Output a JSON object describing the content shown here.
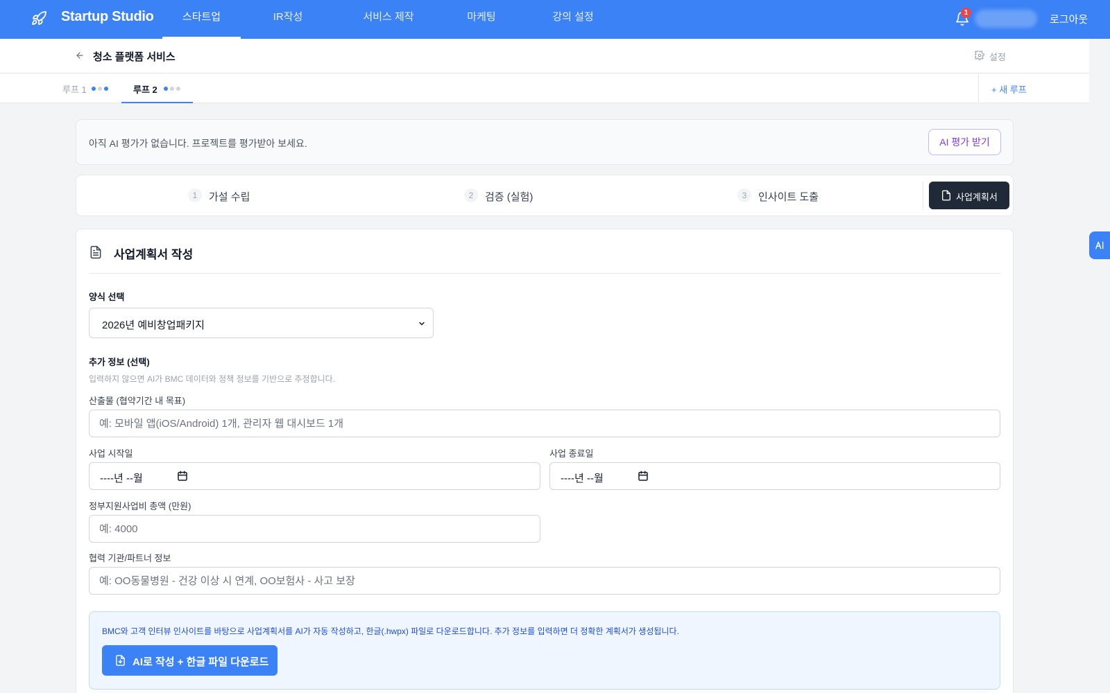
{
  "topnav": {
    "brand": "Startup Studio",
    "items": [
      {
        "label": "스타트업"
      },
      {
        "label": "IR작성"
      },
      {
        "label": "서비스 제작"
      },
      {
        "label": "마케팅"
      },
      {
        "label": "강의 설정"
      }
    ],
    "active_item": "스타트업",
    "notification_count": "1",
    "logout_label": "로그아웃"
  },
  "page_header": {
    "title": "청소 플랫폼 서비스",
    "settings_label": "설정"
  },
  "loops": {
    "tabs": [
      {
        "label": "루프 1",
        "progress": [
          true,
          false,
          true
        ]
      },
      {
        "label": "루프 2",
        "progress": [
          true,
          false,
          false
        ]
      }
    ],
    "active_tab": "루프 2",
    "new_loop_label": "+ 새 루프"
  },
  "ai_eval": {
    "message": "아직 AI 평가가 없습니다. 프로젝트를 평가받아 보세요.",
    "button_label": "AI 평가 받기"
  },
  "steps": {
    "items": [
      {
        "num": "1",
        "label": "가설 수립"
      },
      {
        "num": "2",
        "label": "검증 (실험)"
      },
      {
        "num": "3",
        "label": "인사이트 도출"
      }
    ],
    "business_plan_button": "사업계획서"
  },
  "business_plan": {
    "title": "사업계획서 작성",
    "template_label": "양식 선택",
    "template_selected": "2026년 예비창업패키지",
    "extra_label": "추가 정보 (선택)",
    "extra_hint": "입력하지 않으면 AI가 BMC 데이터와 정책 정보를 기반으로 추정합니다.",
    "deliverables": {
      "label": "산출물 (협약기간 내 목표)",
      "placeholder": "예: 모바일 앱(iOS/Android) 1개, 관리자 웹 대시보드 1개",
      "value": ""
    },
    "start_date": {
      "label": "사업 시작일",
      "value": "----년 --월"
    },
    "end_date": {
      "label": "사업 종료일",
      "value": "----년 --월"
    },
    "budget": {
      "label": "정부지원사업비 총액 (만원)",
      "placeholder": "예: 4000",
      "value": ""
    },
    "partners": {
      "label": "협력 기관/파트너 정보",
      "placeholder": "예: OO동물병원 - 건강 이상 시 연계, OO보험사 - 사고 보장",
      "value": ""
    },
    "info_text": "BMC와 고객 인터뷰 인사이트를 바탕으로 사업계획서를 AI가 자동 작성하고, 한글(.hwpx) 파일로 다운로드합니다. 추가 정보를 입력하면 더 정확한 계획서가 생성됩니다.",
    "generate_button": "AI로 작성 + 한글 파일 다운로드"
  },
  "side_widget_label": "AI",
  "colors": {
    "primary": "#3b82f6",
    "dark_button": "#1f2937",
    "ai_accent": "#7c3aed",
    "notification": "#ef4444",
    "page_bg": "#f3f4f6"
  }
}
